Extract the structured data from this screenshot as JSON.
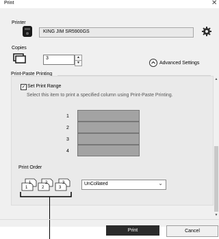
{
  "window": {
    "title": "Print",
    "close_glyph": "✕"
  },
  "printer": {
    "label": "Printer",
    "name": "KING JIM SR5900GS"
  },
  "copies": {
    "label": "Copies",
    "value": "3"
  },
  "advanced": {
    "label": "Advanced Settings"
  },
  "section": {
    "title": "Print-Paste Printing",
    "checkbox_label": "Set Print Range",
    "checkbox_checked": true,
    "description": "Select this item to print a specified column using Print-Paste Printing."
  },
  "print_range": {
    "rows": [
      "1",
      "2",
      "3",
      "4"
    ]
  },
  "print_order": {
    "label": "Print Order",
    "selected": "UnCollated",
    "illustration_digits": [
      "1",
      "1",
      "2",
      "2",
      "3",
      "3"
    ]
  },
  "footer": {
    "print_label": "Print",
    "cancel_label": "Cancel"
  },
  "colors": {
    "print_button": "#2b2b2b",
    "range_cells": "#a3a3a3",
    "dialog_bg": "#f0f0f0"
  },
  "icons": [
    "printer-device-icon",
    "gear-icon",
    "copies-stack-icon",
    "chevron-up-icon",
    "close-icon",
    "chevron-down-icon"
  ]
}
